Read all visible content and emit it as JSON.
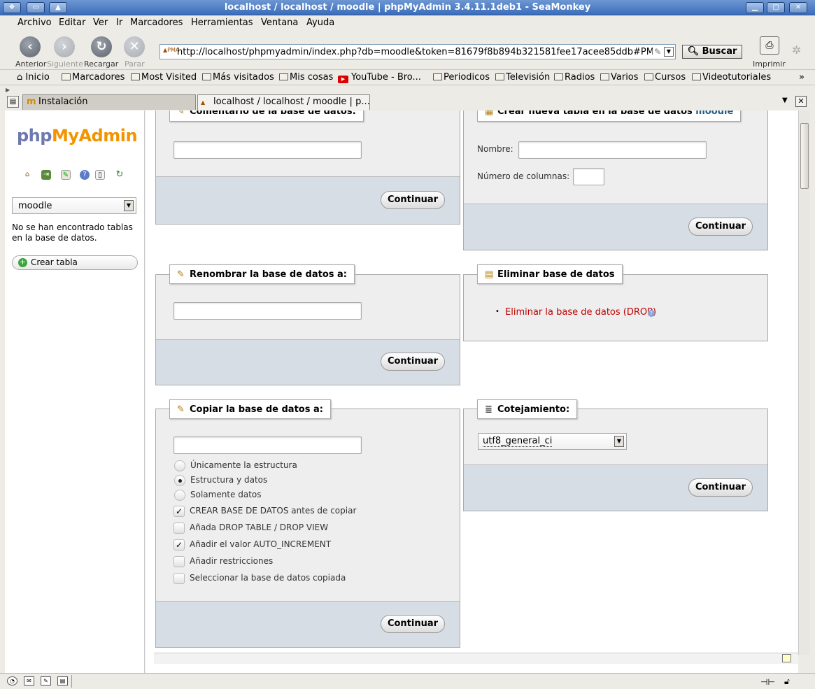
{
  "window": {
    "title": "localhost / localhost / moodle | phpMyAdmin 3.4.11.1deb1 - SeaMonkey"
  },
  "menu": [
    "Archivo",
    "Editar",
    "Ver",
    "Ir",
    "Marcadores",
    "Herramientas",
    "Ventana",
    "Ayuda"
  ],
  "nav": {
    "back": "Anterior",
    "forward": "Siguiente",
    "reload": "Recargar",
    "stop": "Parar",
    "print": "Imprimir",
    "search": "Buscar",
    "url": "http://localhost/phpmyadmin/index.php?db=moodle&token=81679f8b894b321581fee17acee85ddb#PMAURL:db"
  },
  "bookmarks": [
    "Inicio",
    "Marcadores",
    "Most Visited",
    "Más visitados",
    "Mis cosas",
    "YouTube - Bro...",
    "Periodicos",
    "Televisión",
    "Radios",
    "Varios",
    "Cursos",
    "Videotutoriales"
  ],
  "tabs": [
    "Instalación",
    "localhost / localhost / moodle | p..."
  ],
  "sidebar": {
    "logo_php": "php",
    "logo_my": "My",
    "logo_admin": "Admin",
    "db_selected": "moodle",
    "no_tables": "No se han encontrado tablas en la base de datos.",
    "create_table": "Crear tabla"
  },
  "main": {
    "comment_legend": "Comentario de la base de datos:",
    "create_table_legend": "Crear nueva tabla en la base de datos",
    "create_table_db": "moodle",
    "name_label": "Nombre:",
    "cols_label": "Número de columnas:",
    "continue": "Continuar",
    "rename_legend": "Renombrar la base de datos a:",
    "drop_legend": "Eliminar base de datos",
    "drop_link": "Eliminar la base de datos (DROP)",
    "copy_legend": "Copiar la base de datos a:",
    "copy_options": [
      {
        "label": "Únicamente la estructura",
        "type": "radio",
        "checked": false
      },
      {
        "label": "Estructura y datos",
        "type": "radio",
        "checked": true
      },
      {
        "label": "Solamente datos",
        "type": "radio",
        "checked": false
      },
      {
        "label": "CREAR BASE DE DATOS antes de copiar",
        "type": "checkbox",
        "checked": true
      },
      {
        "label": "Añada DROP TABLE / DROP VIEW",
        "type": "checkbox",
        "checked": false
      },
      {
        "label": "Añadir el valor AUTO_INCREMENT",
        "type": "checkbox",
        "checked": true
      },
      {
        "label": "Añadir restricciones",
        "type": "checkbox",
        "checked": false
      },
      {
        "label": "Seleccionar la base de datos copiada",
        "type": "checkbox",
        "checked": false
      }
    ],
    "collation_legend": "Cotejamiento:",
    "collation_value": "utf8_general_ci"
  },
  "colors": {
    "accent": "#3b6dbb",
    "drop": "#c00000",
    "panel_footer": "#d7dde4",
    "logo_orange": "#f29400",
    "logo_blue": "#6c78af"
  }
}
